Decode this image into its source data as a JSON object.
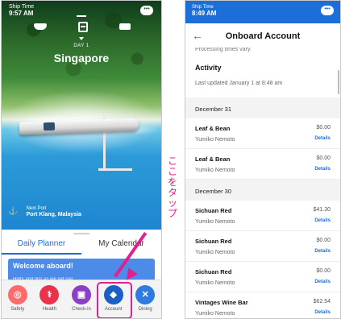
{
  "left": {
    "status": {
      "label": "Ship Time",
      "time": "9:57 AM"
    },
    "chat_icon": "speech-bubble-icon",
    "day": "DAY 1",
    "city": "Singapore",
    "next_port": {
      "label": "Next Port",
      "name": "Port Klang, Malaysia"
    },
    "tabs": [
      {
        "label": "Daily Planner",
        "active": true
      },
      {
        "label": "My Calendar",
        "active": false
      }
    ],
    "welcome": {
      "title": "Welcome aboard!",
      "subtitle": "Hints and tips as we set sail"
    },
    "nav": [
      {
        "label": "Safety",
        "icon": "lifebuoy-icon",
        "color": "#ff6b6b"
      },
      {
        "label": "Health",
        "icon": "caduceus-icon",
        "color": "#e8334a"
      },
      {
        "label": "Check-in",
        "icon": "passport-icon",
        "color": "#8a3fc7"
      },
      {
        "label": "Account",
        "icon": "wallet-icon",
        "color": "#1c5fc4"
      },
      {
        "label": "Dining",
        "icon": "utensils-icon",
        "color": "#2f7be0"
      }
    ]
  },
  "annotation": {
    "text": "ここをタップ",
    "color": "#e0208f"
  },
  "right": {
    "status": {
      "label": "Ship Time",
      "time": "8:49 AM"
    },
    "title": "Onboard Account",
    "processing_note": "Processing times vary.",
    "activity": {
      "heading": "Activity",
      "updated": "Last updated January 1 at 8:48 am"
    },
    "groups": [
      {
        "date": "December 31",
        "rows": [
          {
            "merchant": "Leaf & Bean",
            "person": "Yumiko Nemoto",
            "amount": "$0.00",
            "details": "Details"
          },
          {
            "merchant": "Leaf & Bean",
            "person": "Yumiko Nemoto",
            "amount": "$0.00",
            "details": "Details"
          }
        ]
      },
      {
        "date": "December 30",
        "rows": [
          {
            "merchant": "Sichuan Red",
            "person": "Yumiko Nemoto",
            "amount": "$41.30",
            "details": "Details"
          },
          {
            "merchant": "Sichuan Red",
            "person": "Yumiko Nemoto",
            "amount": "$0.00",
            "details": "Details"
          },
          {
            "merchant": "Sichuan Red",
            "person": "Yumiko Nemoto",
            "amount": "$0.00",
            "details": "Details"
          },
          {
            "merchant": "Vintages Wine Bar",
            "person": "Yumiko Nemoto",
            "amount": "$62.54",
            "details": "Details"
          }
        ]
      }
    ]
  }
}
